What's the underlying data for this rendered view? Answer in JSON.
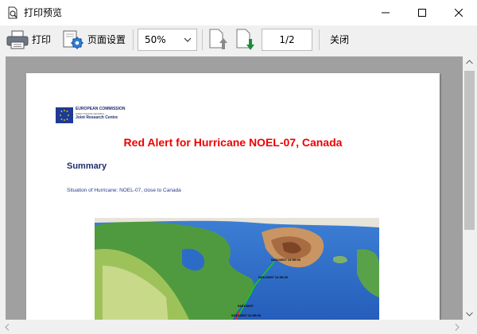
{
  "window": {
    "title": "打印预览",
    "icon": "print-preview-icon"
  },
  "toolbar": {
    "print_label": "打印",
    "page_setup_label": "页面设置",
    "zoom_value": "50%",
    "page_value": "1/2",
    "close_label": "关闭"
  },
  "document": {
    "logo_line1": "EUROPEAN COMMISSION",
    "logo_line2": "DIRECTORATE-GENERAL",
    "logo_line3": "Joint Research Centre",
    "title": "Red Alert for Hurricane NOEL-07, Canada",
    "summary_heading": "Summary",
    "situation_text": "Situation of Hurricane: NOEL-07, close to Canada",
    "map_labels": {
      "label1": "04/11/2007 12:00:00",
      "label2": "03/11/2007 12:00:00",
      "label3": "04/11/2007",
      "label4": "03/11/2007 12:00:00"
    }
  },
  "colors": {
    "title_red": "#ee0000",
    "heading_blue": "#1f2d6b",
    "preview_bg": "#a0a0a0"
  }
}
